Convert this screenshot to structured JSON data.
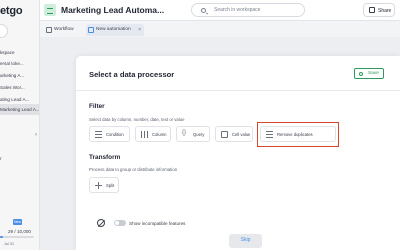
{
  "sidebar": {
    "logo": "etgo",
    "items": [
      {
        "label": "kspace"
      },
      {
        "label": "ersal toke..."
      },
      {
        "label": "arketing A..."
      },
      {
        "label": "Sales Wor..."
      },
      {
        "label": "ating Lead A..."
      },
      {
        "label": "Marketing Lead A..."
      }
    ],
    "lower_item_1": "r",
    "lower_item_2": "",
    "new_badge": "New",
    "usage": "29 / 10,000",
    "date": "Jul 31"
  },
  "topbar": {
    "title": "Marketing Lead Automa...",
    "search_placeholder": "Search in workspace",
    "share_label": "Share"
  },
  "tabs": [
    {
      "label": "Workflow"
    },
    {
      "label": "New automation"
    }
  ],
  "modal": {
    "title": "Select a data processor",
    "save_label": "Save",
    "filter": {
      "title": "Filter",
      "subtitle": "Select data by column, number, date, text or value",
      "items": [
        {
          "label": "Condition",
          "icon": "condition-icon"
        },
        {
          "label": "Column",
          "icon": "column-icon"
        },
        {
          "label": "Query",
          "icon": "query-icon"
        },
        {
          "label": "Cell value",
          "icon": "cell-value-icon"
        },
        {
          "label": "Remove duplicates",
          "icon": "remove-duplicates-icon"
        }
      ]
    },
    "transform": {
      "title": "Transform",
      "subtitle": "Process data to group or distribute information",
      "items": [
        {
          "label": "Split",
          "icon": "split-icon"
        }
      ]
    },
    "toggle_label": "Show incompatible features",
    "skip_label": "Skip"
  },
  "colors": {
    "accent": "#4a8fe7",
    "save_green": "#2f9a5f",
    "highlight_red": "#d9472b"
  }
}
